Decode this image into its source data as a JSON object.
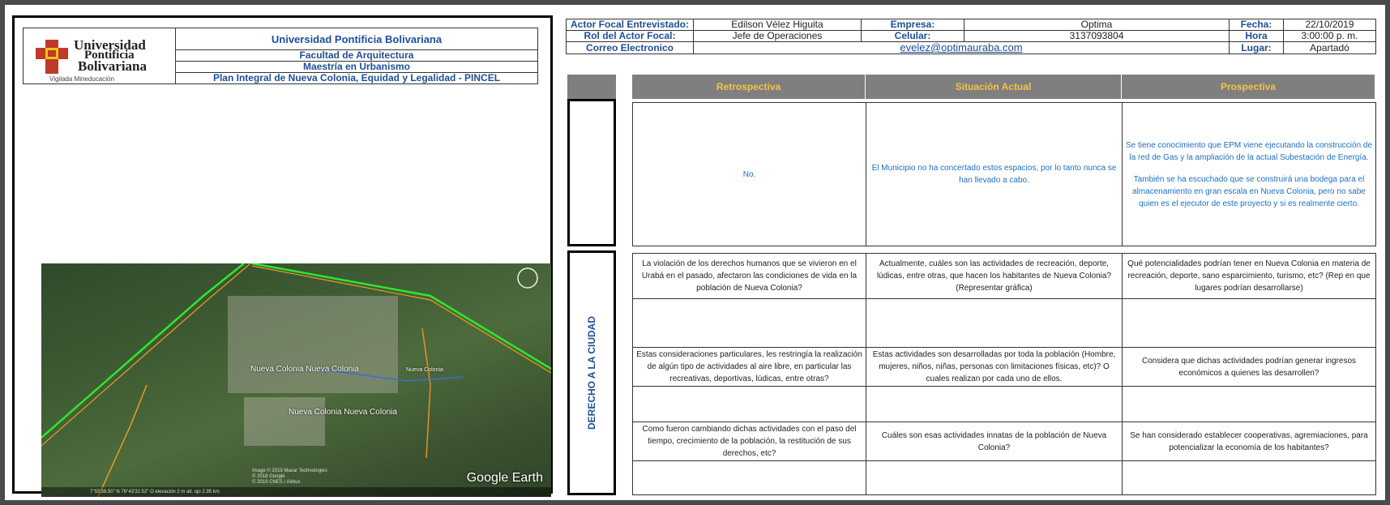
{
  "header": {
    "university_logo_lines": [
      "Universidad",
      "Pontificia",
      "Bolivariana"
    ],
    "logo_caption": "Vigilada Mineducación",
    "lines": [
      "Universidad Pontificia Bolivariana",
      "Facultad de Arquitectura",
      "Maestría en Urbanismo",
      "Plan Integral de Nueva Colonia, Equidad y Legalidad - PINCEL"
    ]
  },
  "map": {
    "labels": [
      "Nueva Colonia Nueva Colonia",
      "Nueva Colonia Nueva Colonia",
      "Nueva Colonia"
    ],
    "brand": "Google Earth",
    "credits": [
      "Image © 2019 Maxar Technologies",
      "© 2018 Google",
      "© 2019 CNES / Airbus"
    ],
    "footer": "7°55'38.50\" N  76°43'32.52\" O  elevación  2 m    alt. ojo  2.95 km"
  },
  "info": {
    "actor_label": "Actor Focal Entrevistado:",
    "actor_value": "Edilson Vélez Higuita",
    "empresa_label": "Empresa:",
    "empresa_value": "Optima",
    "fecha_label": "Fecha:",
    "fecha_value": "22/10/2019",
    "rol_label": "Rol del Actor Focal:",
    "rol_value": "Jefe de Operaciones",
    "celular_label": "Celular:",
    "celular_value": "3137093804",
    "hora_label": "Hora",
    "hora_value": "3:00:00 p. m.",
    "correo_label": "Correo Electronico",
    "correo_value": "evelez@optimauraba.com",
    "lugar_label": "Lugar:",
    "lugar_value": "Apartadó"
  },
  "columns": [
    "Retrospectiva",
    "Situación Actual",
    "Prospectiva"
  ],
  "section_label": "DERECHO A LA CIUDAD",
  "first_block": {
    "retro": "No.",
    "actual": "El Municipio no ha concertado estos espacios, por lo tanto nunca se han llevado a cabo.",
    "prosp_1": "Se tiene conocimiento que EPM viene ejecutando la construcción de la red de Gas y la ampliación de la actual Subestación de Energía.",
    "prosp_2": "También se ha escuchado que se construirá una bodega para el almacenamiento en gran escala en Nueva Colonia, pero no sabe quien es el ejecutor de este proyecto y si es realmente cierto."
  },
  "questions": [
    {
      "retro": "La violación de los derechos humanos que se vivieron en el Urabá en el pasado, afectaron las condiciones de vida en la población de Nueva Colonia?",
      "actual": "Actualmente, cuáles son las actividades de recreación, deporte, lúdicas, entre otras, que hacen los habitantes de Nueva Colonia? (Representar gráfica)",
      "prosp": "Qué potencialidades podrían tener en Nueva Colonia en materia de recreación, deporte, sano esparcimiento, turismo, etc? (Rep en que lugares podrían desarrollarse)"
    },
    {
      "retro": "Estas consideraciones particulares, les restringía la realización de algún tipo de actividades al aire libre, en particular las recreativas, deportivas, lúdicas, entre otras?",
      "actual": "Estas actividades son desarrolladas por toda la población (Hombre, mujeres, niños, niñas, personas con limitaciones físicas, etc)? O cuales realizan por cada uno de ellos.",
      "prosp": "Considera que dichas actividades podrían generar ingresos económicos a quienes las desarrollen?"
    },
    {
      "retro": "Como fueron cambiando dichas actividades con el paso del tiempo, crecimiento de la población, la restitución de sus derechos, etc?",
      "actual": "Cuáles son esas actividades innatas de la población de Nueva Colonia?",
      "prosp": "Se han considerado establecer cooperativas, agremiaciones, para potencializar la economía de los habitantes?"
    }
  ]
}
